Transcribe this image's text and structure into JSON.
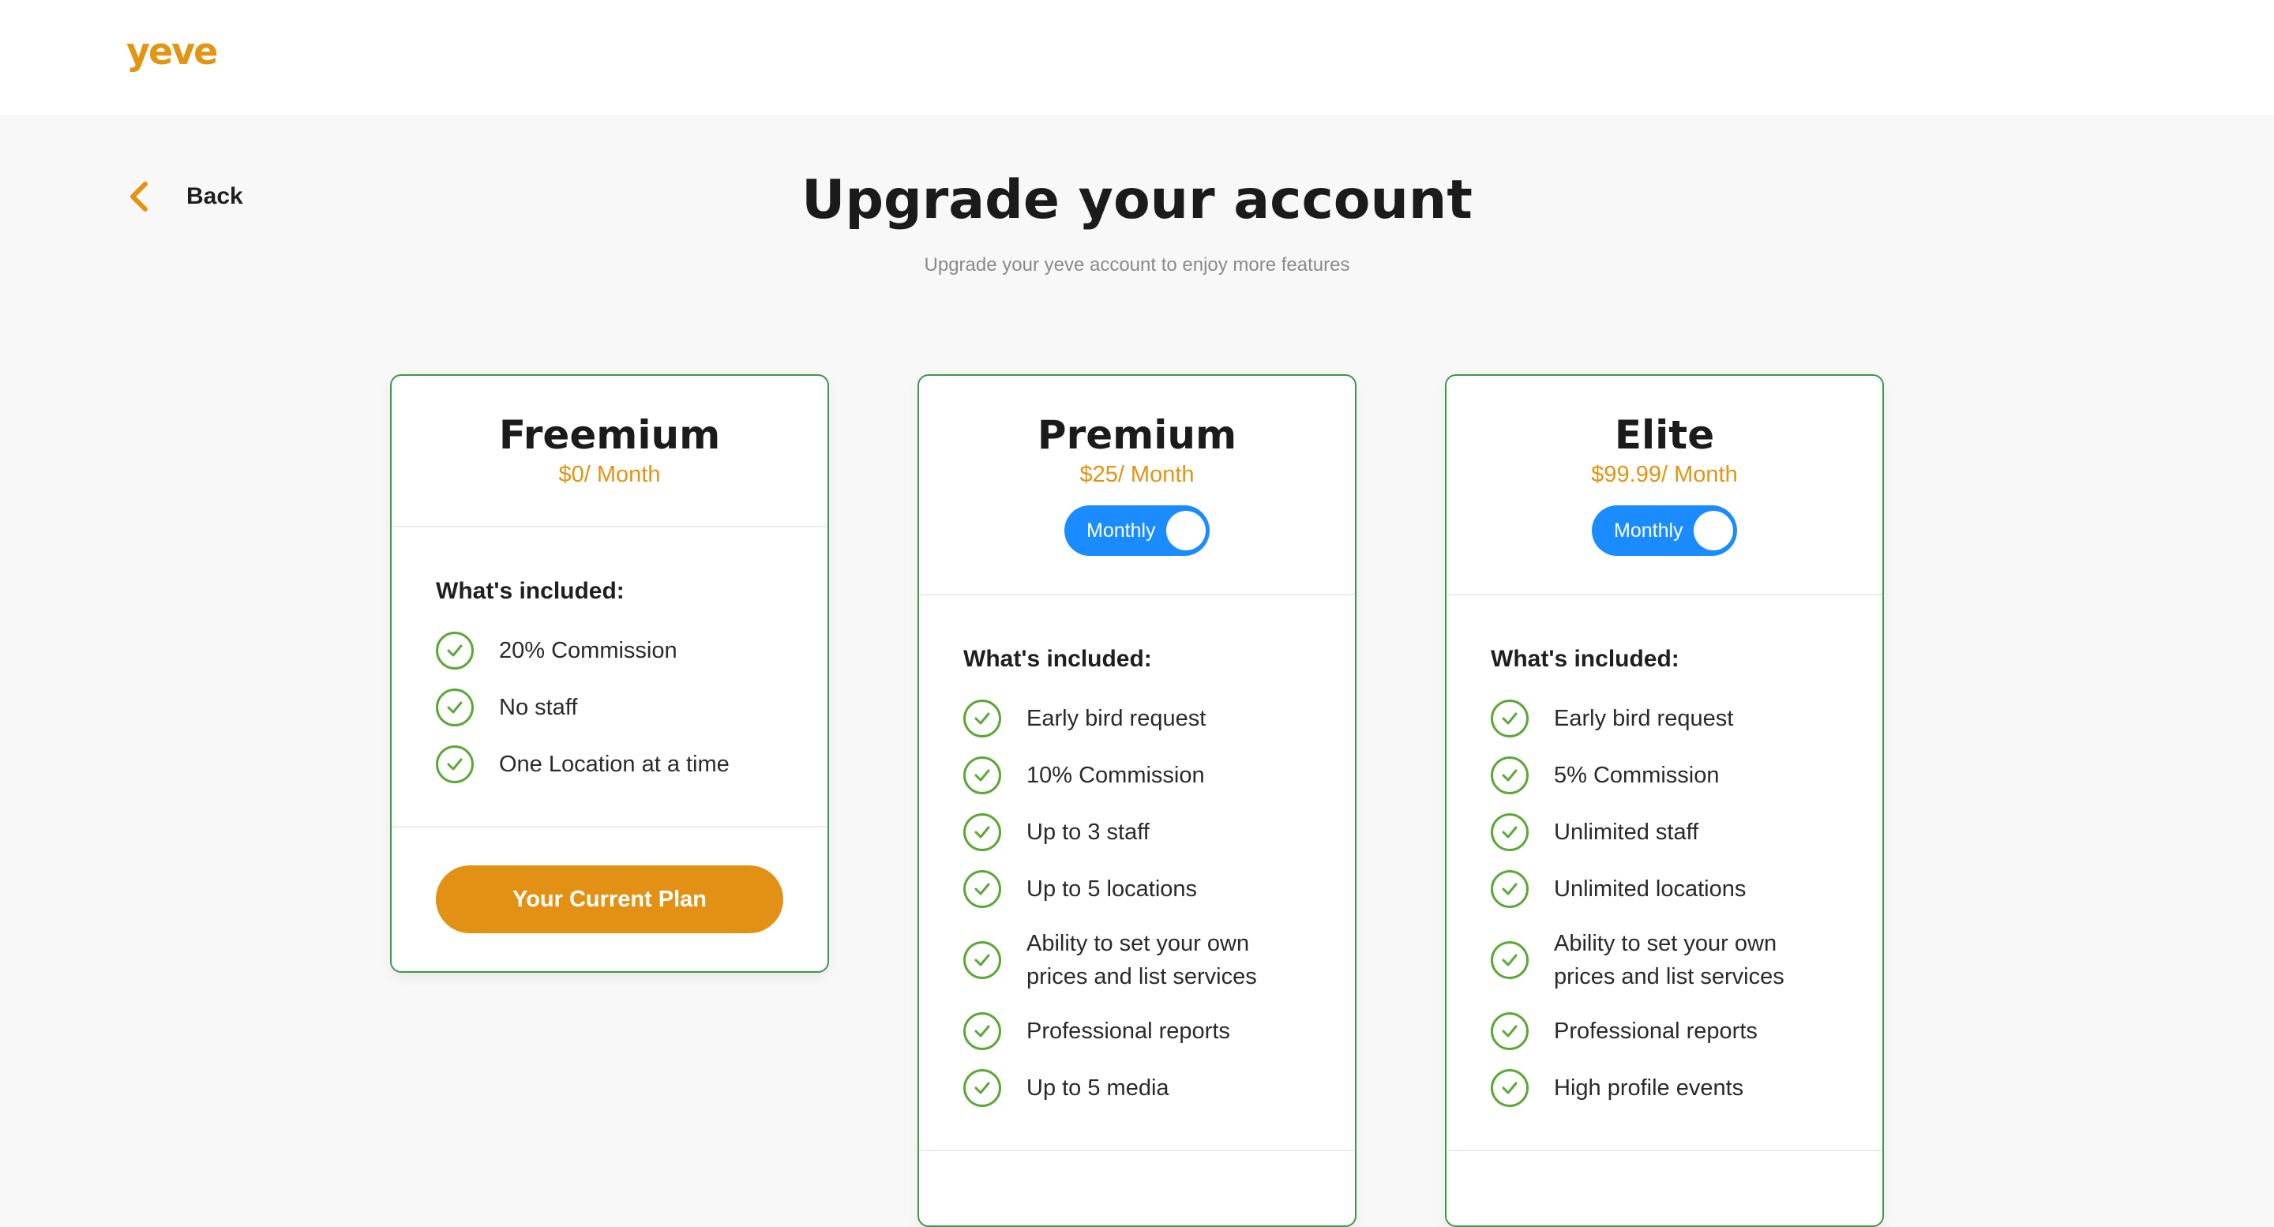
{
  "header": {
    "logo_text": "yeve"
  },
  "nav": {
    "back_label": "Back"
  },
  "page": {
    "title": "Upgrade your account",
    "subtitle": "Upgrade your yeve account to enjoy more features"
  },
  "colors": {
    "brand": "#e29412",
    "card_border": "#3a9a4a",
    "check": "#5aa838",
    "toggle": "#1a8cff"
  },
  "plans": [
    {
      "name": "Freemium",
      "price": "$0/ Month",
      "included_label": "What's included:",
      "features": [
        "20% Commission",
        "No staff",
        "One Location at a time"
      ],
      "cta_label": "Your Current Plan"
    },
    {
      "name": "Premium",
      "price": "$25/ Month",
      "toggle_label": "Monthly",
      "included_label": "What's included:",
      "features": [
        "Early bird request",
        "10% Commission",
        "Up to 3 staff",
        "Up to 5 locations",
        "Ability to set your own prices and list services",
        "Professional reports",
        "Up to 5 media"
      ]
    },
    {
      "name": "Elite",
      "price": "$99.99/ Month",
      "toggle_label": "Monthly",
      "included_label": "What's included:",
      "features": [
        "Early bird request",
        "5% Commission",
        "Unlimited staff",
        "Unlimited locations",
        "Ability to set your own prices and list services",
        "Professional reports",
        "High profile events"
      ]
    }
  ]
}
